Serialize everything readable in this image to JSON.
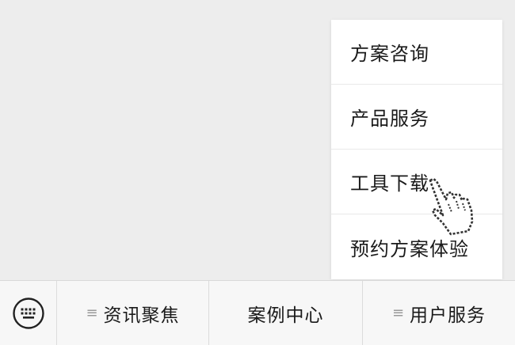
{
  "popup_menu": {
    "items": [
      {
        "label": "方案咨询"
      },
      {
        "label": "产品服务"
      },
      {
        "label": "工具下载"
      },
      {
        "label": "预约方案体验"
      }
    ]
  },
  "bottom_bar": {
    "keyboard_icon": "keyboard-icon",
    "menus": [
      {
        "label": "资讯聚焦",
        "icon": "≡"
      },
      {
        "label": "案例中心"
      },
      {
        "label": "用户服务",
        "icon": "≡"
      }
    ]
  },
  "colors": {
    "background": "#ededed",
    "popup_background": "#ffffff",
    "bar_background": "#f7f7f7",
    "text": "#1a1a1a"
  }
}
